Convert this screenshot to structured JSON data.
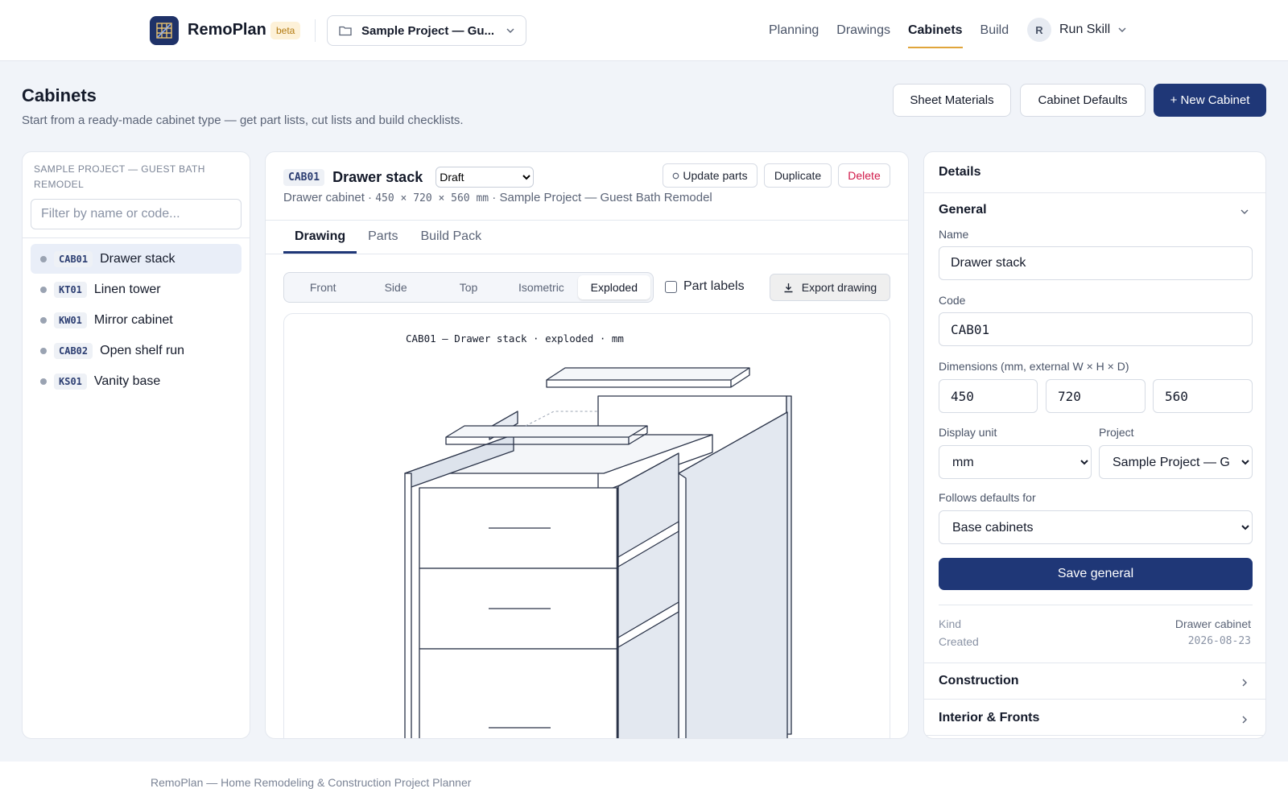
{
  "app": {
    "name": "RemoPlan",
    "badge": "beta"
  },
  "project_selector": {
    "label": "Sample Project — Gu..."
  },
  "nav": {
    "items": [
      "Planning",
      "Drawings",
      "Cabinets",
      "Build"
    ],
    "active": "Cabinets"
  },
  "user": {
    "initial": "R",
    "name": "Run Skill"
  },
  "header": {
    "title": "Cabinets",
    "subtitle": "Start from a ready-made cabinet type — get part lists, cut lists and build checklists.",
    "buttons": {
      "sheet_materials": "Sheet Materials",
      "cabinet_defaults": "Cabinet Defaults",
      "new_cabinet": "+ New Cabinet"
    }
  },
  "sidebar": {
    "project_title": "Sample Project — Guest Bath Remodel",
    "filter_placeholder": "Filter by name or code...",
    "cabinets": [
      {
        "code": "CAB01",
        "name": "Drawer stack"
      },
      {
        "code": "KT01",
        "name": "Linen tower"
      },
      {
        "code": "KW01",
        "name": "Mirror cabinet"
      },
      {
        "code": "CAB02",
        "name": "Open shelf run"
      },
      {
        "code": "KS01",
        "name": "Vanity base"
      }
    ]
  },
  "cabinet": {
    "code": "CAB01",
    "name": "Drawer stack",
    "status": "Draft",
    "kind": "Drawer cabinet",
    "dims_text": "450 × 720 × 560 mm",
    "project": "Sample Project — Guest Bath Remodel",
    "actions": {
      "update_parts": "Update parts",
      "duplicate": "Duplicate",
      "delete": "Delete"
    }
  },
  "tabs": [
    "Drawing",
    "Parts",
    "Build Pack"
  ],
  "active_tab": "Drawing",
  "drawing": {
    "views": [
      "Front",
      "Side",
      "Top",
      "Isometric",
      "Exploded"
    ],
    "active_view": "Exploded",
    "part_labels": "Part labels",
    "part_labels_checked": false,
    "export_label": "Export drawing",
    "caption": "CAB01 — Drawer stack · exploded · mm"
  },
  "details": {
    "heading": "Details",
    "general": {
      "title": "General",
      "name_label": "Name",
      "name_value": "Drawer stack",
      "code_label": "Code",
      "code_value": "CAB01",
      "dims_label": "Dimensions (mm, external W × H × D)",
      "width": "450",
      "height": "720",
      "depth": "560",
      "unit_label": "Display unit",
      "unit_value": "mm",
      "project_label": "Project",
      "project_value": "Sample Project — Guest Bath Remodel",
      "defaults_label": "Follows defaults for",
      "defaults_value": "Base cabinets",
      "save_label": "Save general",
      "kind_label": "Kind",
      "kind_value": "Drawer cabinet",
      "created_label": "Created",
      "created_value": "2026-08-23"
    },
    "construction": "Construction",
    "interior": "Interior & Fronts"
  },
  "footer": "RemoPlan — Home Remodeling & Construction Project Planner",
  "colors": {
    "primary": "#1f3777",
    "accent": "#e0a53b",
    "danger": "#d11a4a"
  }
}
